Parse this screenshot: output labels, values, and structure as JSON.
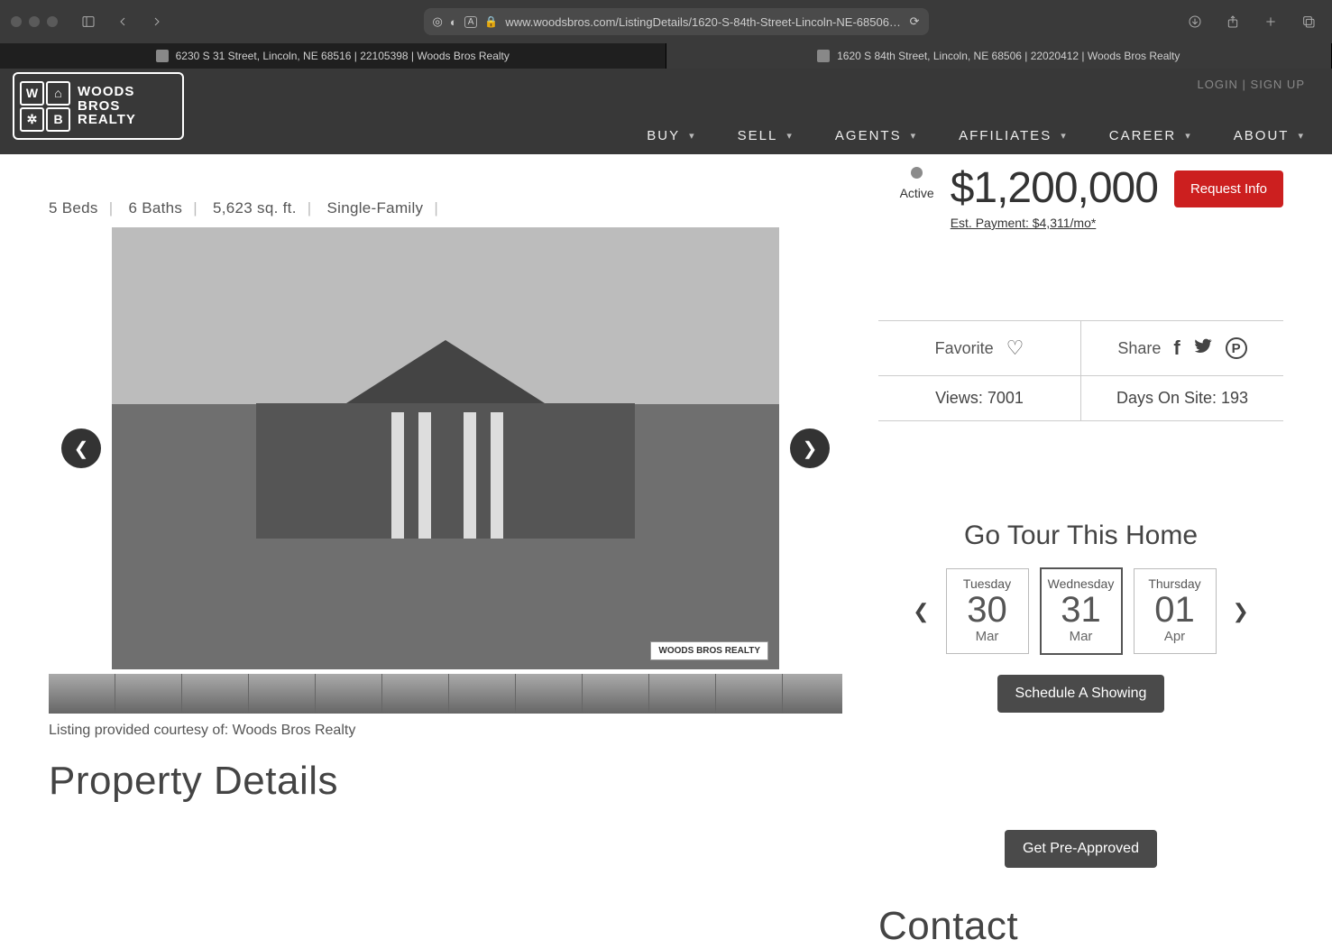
{
  "browser": {
    "url": "www.woodsbros.com/ListingDetails/1620-S-84th-Street-Lincoln-NE-68506/2202",
    "tabs": [
      "6230 S 31 Street, Lincoln, NE 68516 | 22105398 | Woods Bros Realty",
      "1620 S 84th Street, Lincoln, NE 68506 | 22020412 | Woods Bros Realty"
    ],
    "active_tab": 1
  },
  "header": {
    "logo_text": "WOODS\nBROS\nREALTY",
    "top_links": "LOGIN | SIGN UP",
    "nav": [
      "BUY",
      "SELL",
      "AGENTS",
      "AFFILIATES",
      "CAREER",
      "ABOUT"
    ]
  },
  "listing": {
    "status": "Active",
    "price": "$1,200,000",
    "est_payment": "Est. Payment: $4,311/mo*",
    "request_info": "Request Info",
    "beds": "5 Beds",
    "baths": "6 Baths",
    "sqft": "5,623 sq. ft.",
    "type": "Single-Family",
    "watermark": "WOODS BROS REALTY",
    "courtesy": "Listing provided courtesy of: Woods Bros Realty",
    "favorite_label": "Favorite",
    "share_label": "Share",
    "views_label": "Views: 7001",
    "days_label": "Days On Site: 193"
  },
  "tour": {
    "title": "Go Tour This Home",
    "dates": [
      {
        "dow": "Tuesday",
        "num": "30",
        "mon": "Mar"
      },
      {
        "dow": "Wednesday",
        "num": "31",
        "mon": "Mar"
      },
      {
        "dow": "Thursday",
        "num": "01",
        "mon": "Apr"
      }
    ],
    "active_index": 1,
    "schedule": "Schedule A Showing",
    "preapproved": "Get Pre-Approved"
  },
  "sections": {
    "property_details": "Property Details",
    "contact": "Contact"
  }
}
